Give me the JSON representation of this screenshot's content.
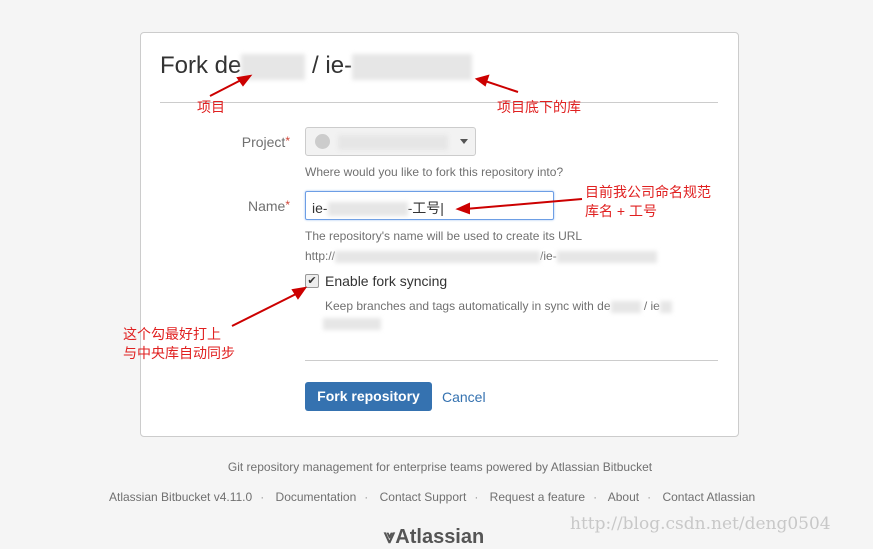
{
  "title": {
    "prefix": "Fork de",
    "middle": "/ ie-"
  },
  "form": {
    "project_label": "Project",
    "required_mark": "*",
    "project_help": "Where would you like to fork this repository into?",
    "name_label": "Name",
    "name_value_prefix": "ie-",
    "name_value_suffix": "-工号",
    "name_help": "The repository's name will be used to create its URL",
    "url_prefix": "http://",
    "url_middle": "/ie-",
    "sync_label": "Enable fork syncing",
    "sync_checked": true,
    "sync_help_prefix": "Keep branches and tags automatically in sync with de",
    "sync_help_mid": "/ ie",
    "submit": "Fork repository",
    "cancel": "Cancel"
  },
  "annotations": {
    "project": "项目",
    "repo": "项目底下的库",
    "naming_line1": "目前我公司命名规范",
    "naming_line2": "库名 + 工号",
    "sync_line1": "这个勾最好打上",
    "sync_line2": "与中央库自动同步",
    "color": "#e02020"
  },
  "footer": {
    "tagline": "Git repository management for enterprise teams powered by Atlassian Bitbucket",
    "links": [
      "Atlassian Bitbucket v4.11.0",
      "Documentation",
      "Contact Support",
      "Request a feature",
      "About",
      "Contact Atlassian"
    ],
    "logo": "Atlassian"
  },
  "watermark": "http://blog.csdn.net/deng0504",
  "colors": {
    "primary": "#3572b0",
    "background": "#f5f5f5"
  }
}
